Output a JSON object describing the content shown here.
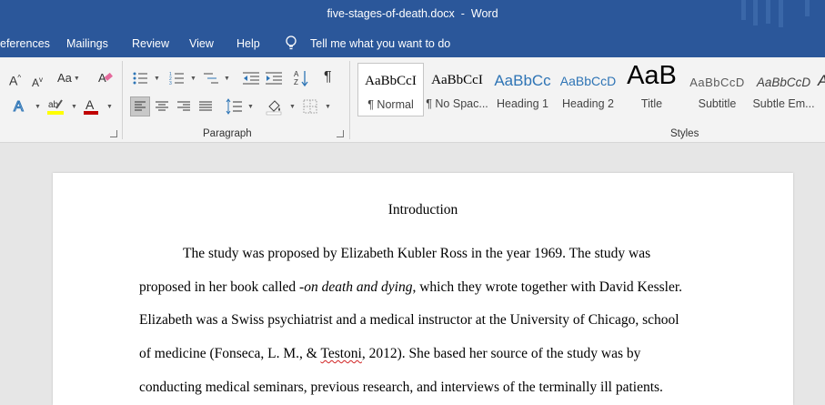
{
  "window": {
    "doc_name": "five-stages-of-death.docx",
    "separator": "-",
    "app": "Word"
  },
  "menu": {
    "items": [
      "eferences",
      "Mailings",
      "Review",
      "View",
      "Help"
    ],
    "tell_me": "Tell me what you want to do"
  },
  "ribbon": {
    "font_grow": "A",
    "font_shrink": "A",
    "change_case": "Aa",
    "paragraph_mark": "¶",
    "paragraph_label": "Paragraph",
    "styles_label": "Styles",
    "colors": {
      "highlight": "#ffff00",
      "font_color": "#c00000",
      "text_effect": "#2e75b6"
    }
  },
  "styles": [
    {
      "preview": "AaBbCcI",
      "name": "¶ Normal"
    },
    {
      "preview": "AaBbCcI",
      "name": "¶ No Spac..."
    },
    {
      "preview": "AaBbCc",
      "name": "Heading 1"
    },
    {
      "preview": "AaBbCcD",
      "name": "Heading 2"
    },
    {
      "preview": "AaB",
      "name": "Title"
    },
    {
      "preview": "AaBbCcD",
      "name": "Subtitle"
    },
    {
      "preview": "AaBbCcD",
      "name": "Subtle Em..."
    }
  ],
  "document": {
    "heading": "Introduction",
    "line1": "The study was proposed by Elizabeth Kubler Ross in the year 1969. The study was",
    "line2_a": "proposed in her book called -",
    "line2_b": "on death and dying",
    "line2_c": ", which they wrote together with David Kessler.",
    "line3": "Elizabeth was a Swiss psychiatrist and a medical instructor at the University of Chicago, school",
    "line4_a": "of medicine (Fonseca, L. M., & ",
    "line4_b": "Testoni",
    "line4_c": ", 2012). She based her source of the study was by",
    "line5": "conducting medical seminars, previous research, and interviews of the terminally ill patients."
  }
}
